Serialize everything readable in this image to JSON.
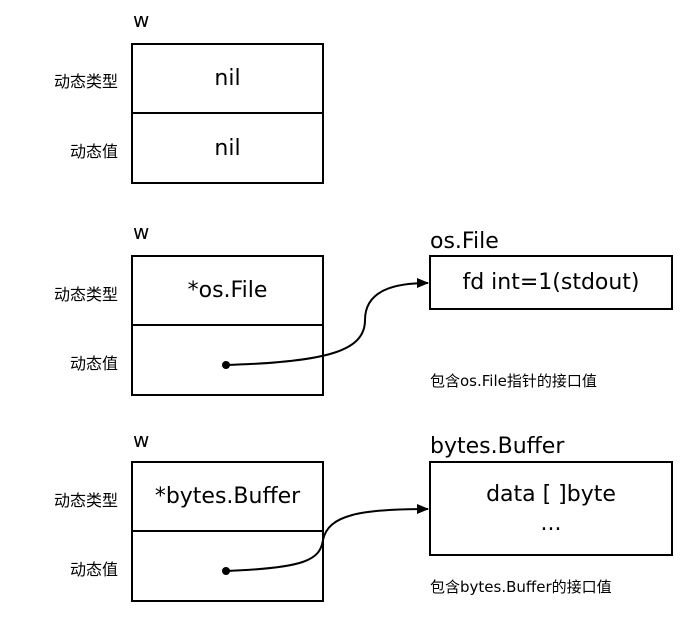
{
  "groups": [
    {
      "var": "w",
      "rows": [
        {
          "label": "动态类型",
          "value": "nil"
        },
        {
          "label": "动态值",
          "value": "nil"
        }
      ]
    },
    {
      "var": "w",
      "rows": [
        {
          "label": "动态类型",
          "value": "*os.File"
        },
        {
          "label": "动态值",
          "value": ""
        }
      ],
      "target": {
        "title": "os.File",
        "lines": [
          "fd int=1(stdout)"
        ]
      },
      "caption": "包含os.File指针的接口值"
    },
    {
      "var": "w",
      "rows": [
        {
          "label": "动态类型",
          "value": "*bytes.Buffer"
        },
        {
          "label": "动态值",
          "value": ""
        }
      ],
      "target": {
        "title": "bytes.Buffer",
        "lines": [
          "data  [ ]byte",
          "..."
        ]
      },
      "caption": "包含bytes.Buffer的接口值"
    }
  ]
}
